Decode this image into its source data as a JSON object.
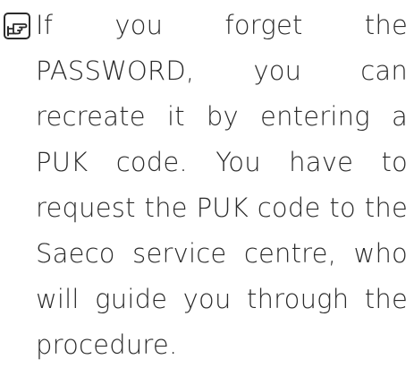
{
  "note": {
    "icon": "pointing-hand-icon",
    "text": "If you forget the PASSWORD, you can recreate it by entering a PUK code. You have to request the PUK code to the Saeco service centre, who will guide you through the procedure."
  }
}
